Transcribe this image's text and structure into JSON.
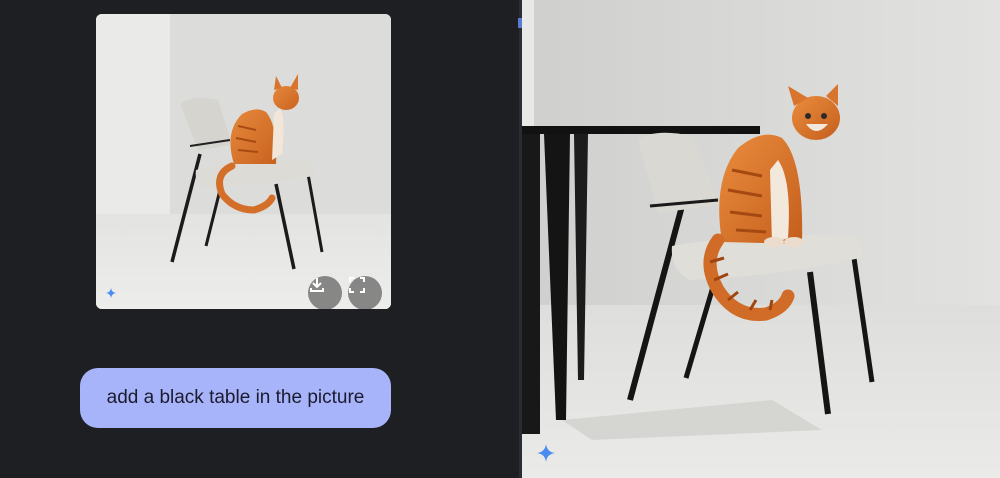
{
  "chat": {
    "prompt_text": "add a black table in the picture"
  },
  "thumbnail": {
    "actions": [
      {
        "name": "download",
        "icon": "download-icon"
      },
      {
        "name": "fullscreen",
        "icon": "fullscreen-icon"
      }
    ]
  },
  "icons": {
    "ai_badge": "sparkle-icon"
  },
  "colors": {
    "panel_background": "#1e1f22",
    "prompt_bubble": "#a8b4fa",
    "prompt_text": "#1a1b2e",
    "sparkle": "#4a8cf0"
  }
}
